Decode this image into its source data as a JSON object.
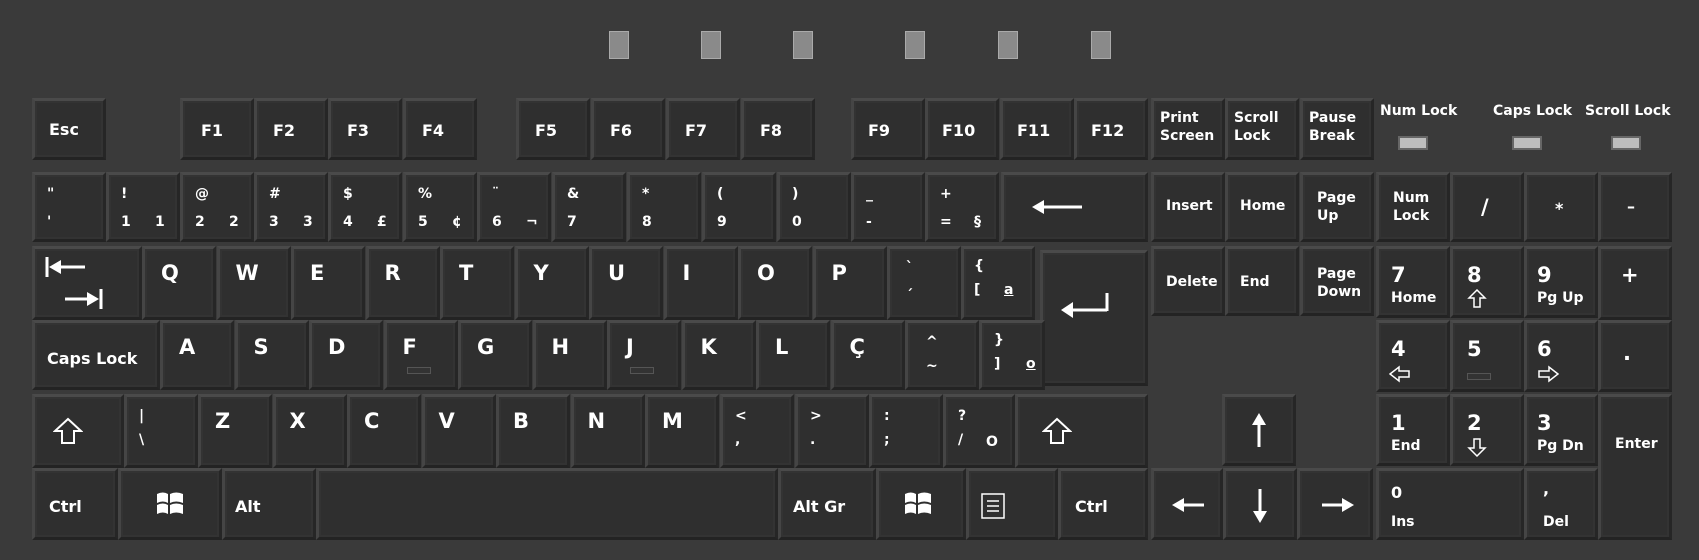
{
  "top_tabs": 6,
  "indicators": [
    {
      "id": "num",
      "label": "Num Lock"
    },
    {
      "id": "caps",
      "label": "Caps Lock"
    },
    {
      "id": "scroll",
      "label": "Scroll Lock"
    }
  ],
  "keys": {
    "esc": "Esc",
    "f1": "F1",
    "f2": "F2",
    "f3": "F3",
    "f4": "F4",
    "f5": "F5",
    "f6": "F6",
    "f7": "F7",
    "f8": "F8",
    "f9": "F9",
    "f10": "F10",
    "f11": "F11",
    "f12": "F12",
    "prtsc": "Print Screen",
    "scrlk": "Scroll Lock",
    "pause": "Pause Break",
    "row1": [
      {
        "t": "\"",
        "b": "'"
      },
      {
        "t": "!",
        "b": "1",
        "r": "1"
      },
      {
        "t": "@",
        "b": "2",
        "r": "2"
      },
      {
        "t": "#",
        "b": "3",
        "r": "3"
      },
      {
        "t": "$",
        "b": "4",
        "r": "£"
      },
      {
        "t": "%",
        "b": "5",
        "r": "¢"
      },
      {
        "t": "¨",
        "b": "6",
        "r": "¬"
      },
      {
        "t": "&",
        "b": "7"
      },
      {
        "t": "*",
        "b": "8"
      },
      {
        "t": "(",
        "b": "9"
      },
      {
        "t": ")",
        "b": "0"
      },
      {
        "t": "_",
        "b": "-"
      },
      {
        "t": "+",
        "b": "=",
        "r": "§"
      }
    ],
    "row2": [
      "Q",
      "W",
      "E",
      "R",
      "T",
      "Y",
      "U",
      "I",
      "O",
      "P"
    ],
    "acute": {
      "t": "`",
      "b": "´"
    },
    "brace_open": {
      "t": "{",
      "b": "[",
      "r": "a"
    },
    "row3": [
      "A",
      "S",
      "D",
      "F",
      "G",
      "H",
      "J",
      "K",
      "L",
      "Ç"
    ],
    "tilde": {
      "t": "^",
      "b": "~"
    },
    "brace_close": {
      "t": "}",
      "b": "]",
      "r": "o"
    },
    "pipe": {
      "t": "|",
      "b": "\\"
    },
    "row4": [
      "Z",
      "X",
      "C",
      "V",
      "B",
      "N",
      "M"
    ],
    "comma": {
      "t": "<",
      "b": ","
    },
    "period": {
      "t": ">",
      "b": "."
    },
    "semicolon": {
      "t": ":",
      "b": ";"
    },
    "slash": {
      "t": "?",
      "b": "/",
      "r": "O"
    },
    "capslock": "Caps Lock",
    "ctrl": "Ctrl",
    "alt": "Alt",
    "altgr": "Alt Gr",
    "rctrl": "Ctrl",
    "insert": "Insert",
    "home": "Home",
    "pageup": "Page Up",
    "delete": "Delete",
    "end": "End",
    "pagedown": "Page Down",
    "numlock": "Num Lock",
    "kp_div": "/",
    "kp_mul": "*",
    "kp_minus": "–",
    "kp_plus": "+",
    "kp7": {
      "n": "7",
      "s": "Home"
    },
    "kp8": {
      "n": "8"
    },
    "kp9": {
      "n": "9",
      "s": "Pg Up"
    },
    "kp4": {
      "n": "4"
    },
    "kp5": {
      "n": "5"
    },
    "kp6": {
      "n": "6"
    },
    "kp_dot_top": ".",
    "kp1": {
      "n": "1",
      "s": "End"
    },
    "kp2": {
      "n": "2"
    },
    "kp3": {
      "n": "3",
      "s": "Pg Dn"
    },
    "kp0": {
      "n": "0",
      "s": "Ins"
    },
    "kp_del": {
      "n": ",",
      "s": "Del"
    },
    "enter": "Enter"
  }
}
